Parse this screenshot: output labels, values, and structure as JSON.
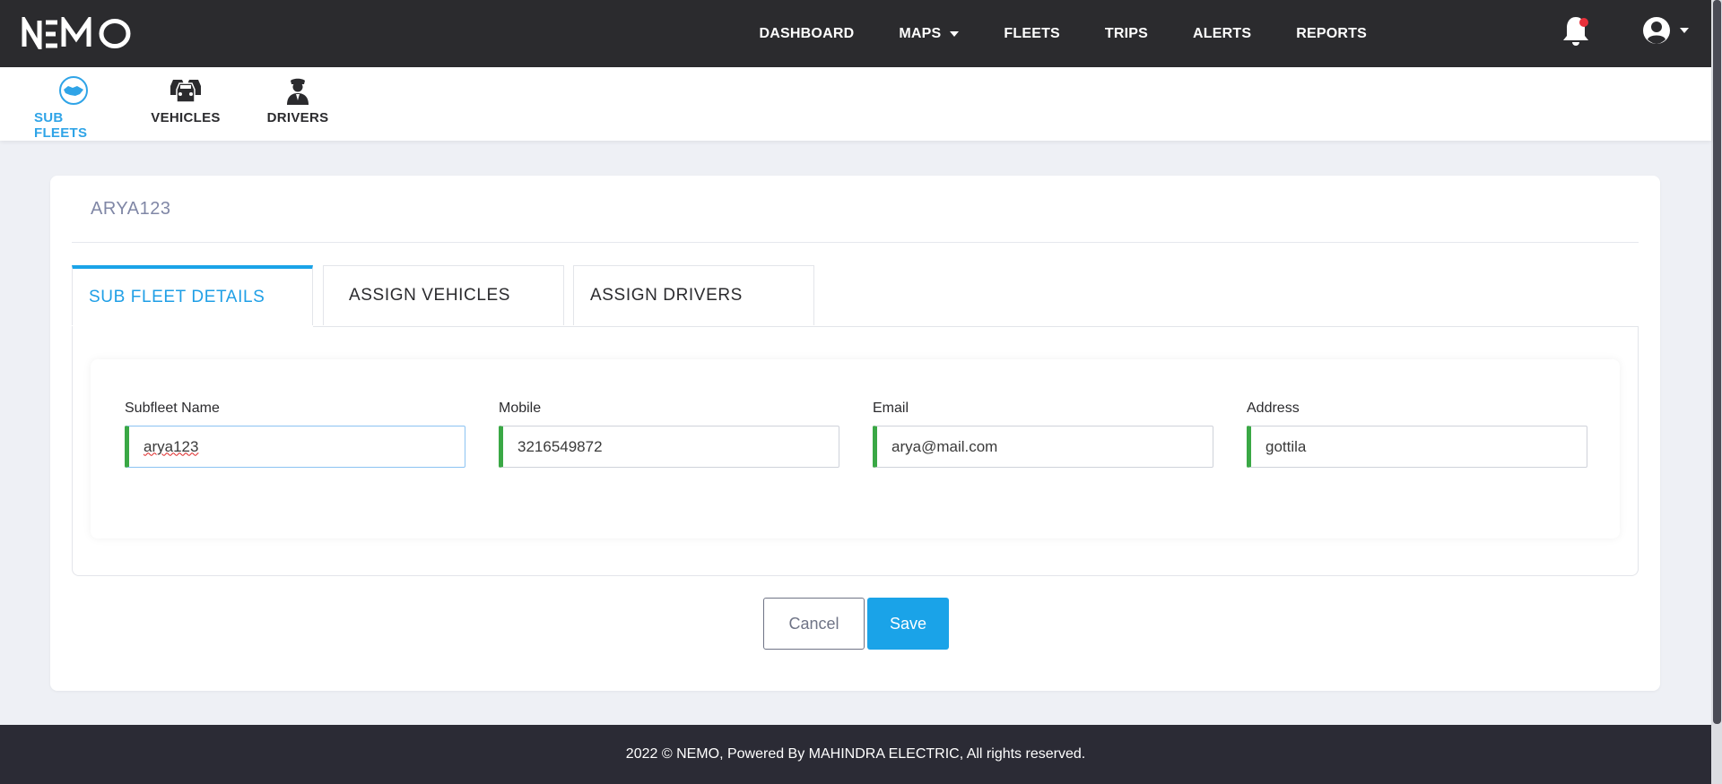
{
  "app": {
    "logo_text": "NEMO"
  },
  "topnav": {
    "items": [
      {
        "label": "DASHBOARD"
      },
      {
        "label": "MAPS"
      },
      {
        "label": "FLEETS"
      },
      {
        "label": "TRIPS"
      },
      {
        "label": "ALERTS"
      },
      {
        "label": "REPORTS"
      }
    ],
    "notification_dot_color": "#e8303a",
    "icons": [
      "bell-icon",
      "user-circle-icon",
      "caret-down-icon"
    ]
  },
  "subnav": {
    "items": [
      {
        "label": "SUB FLEETS",
        "icon": "handshake-icon",
        "active": true
      },
      {
        "label": "VEHICLES",
        "icon": "cars-icon",
        "active": false
      },
      {
        "label": "DRIVERS",
        "icon": "driver-icon",
        "active": false
      }
    ]
  },
  "card": {
    "title": "ARYA123",
    "tabs": [
      {
        "label": "SUB FLEET DETAILS",
        "active": true
      },
      {
        "label": "ASSIGN VEHICLES",
        "active": false
      },
      {
        "label": "ASSIGN DRIVERS",
        "active": false
      }
    ],
    "fields": [
      {
        "label": "Subfleet Name",
        "value": "arya123"
      },
      {
        "label": "Mobile",
        "value": "3216549872"
      },
      {
        "label": "Email",
        "value": "arya@mail.com"
      },
      {
        "label": "Address",
        "value": "gottila"
      }
    ],
    "buttons": {
      "cancel": "Cancel",
      "save": "Save"
    }
  },
  "footer": {
    "text": "2022 © NEMO, Powered By MAHINDRA ELECTRIC, All rights reserved."
  },
  "colors": {
    "accent": "#1aa3e8",
    "valid_border": "#3aa845",
    "topbar": "#2b2b2e"
  }
}
